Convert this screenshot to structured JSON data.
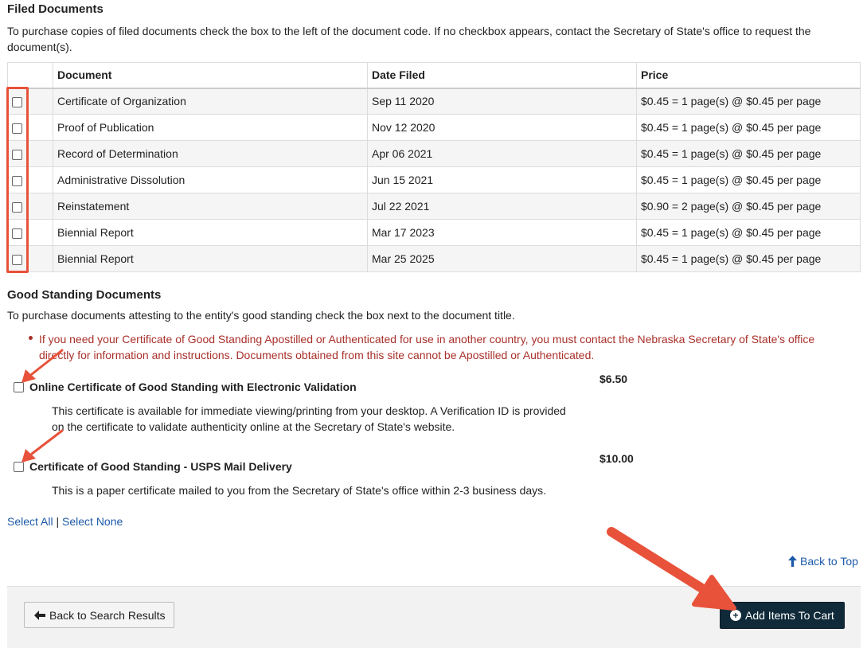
{
  "filed": {
    "heading": "Filed Documents",
    "instructions_line1": "To purchase copies of filed documents check the box to the left of the document code. If no checkbox appears, contact the Secretary of State's office to request the",
    "instructions_line2": "document(s).",
    "columns": [
      "Document",
      "Date Filed",
      "Price"
    ],
    "rows": [
      {
        "document": "Certificate of Organization",
        "date": "Sep 11 2020",
        "price": "$0.45 = 1 page(s) @ $0.45 per page"
      },
      {
        "document": "Proof of Publication",
        "date": "Nov 12 2020",
        "price": "$0.45 = 1 page(s) @ $0.45 per page"
      },
      {
        "document": "Record of Determination",
        "date": "Apr 06 2021",
        "price": "$0.45 = 1 page(s) @ $0.45 per page"
      },
      {
        "document": "Administrative Dissolution",
        "date": "Jun 15 2021",
        "price": "$0.45 = 1 page(s) @ $0.45 per page"
      },
      {
        "document": "Reinstatement",
        "date": "Jul 22 2021",
        "price": "$0.90 = 2 page(s) @ $0.45 per page"
      },
      {
        "document": "Biennial Report",
        "date": "Mar 17 2023",
        "price": "$0.45 = 1 page(s) @ $0.45 per page"
      },
      {
        "document": "Biennial Report",
        "date": "Mar 25 2025",
        "price": "$0.45 = 1 page(s) @ $0.45 per page"
      }
    ]
  },
  "good_standing": {
    "heading": "Good Standing Documents",
    "instructions": "To purchase documents attesting to the entity's good standing check the box next to the document title.",
    "notice_line1": "If you need your Certificate of Good Standing Apostilled or Authenticated for use in another country, you must contact the Nebraska Secretary of State's office",
    "notice_line2": "directly for information and instructions. Documents obtained from this site cannot be Apostilled or Authenticated.",
    "items": [
      {
        "title": "Online Certificate of Good Standing with Electronic Validation",
        "price": "$6.50",
        "desc_line1": "This certificate is available for immediate viewing/printing from your desktop. A Verification ID is provided",
        "desc_line2": "on the certificate to validate authenticity online at the Secretary of State's website."
      },
      {
        "title": "Certificate of Good Standing - USPS Mail Delivery",
        "price": "$10.00",
        "desc_line1": "This is a paper certificate mailed to you from the Secretary of State's office within 2-3 business days."
      }
    ]
  },
  "selection": {
    "select_all": "Select All",
    "separator": "|",
    "select_none": "Select None"
  },
  "back_to_top": "Back to Top",
  "footer": {
    "back_label": "Back to Search Results",
    "cart_label": "Add Items To Cart"
  },
  "colors": {
    "annotation": "#e8523a",
    "link": "#1d5aa8",
    "notice": "#a9302a",
    "cart_button": "#102a3a"
  },
  "icons": {
    "back": "arrow-left-icon",
    "top": "arrow-up-icon",
    "cart": "plus-circle-icon"
  }
}
